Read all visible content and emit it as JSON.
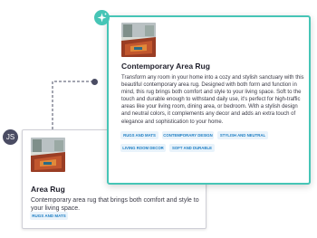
{
  "source_card": {
    "title": "Area Rug",
    "description": "Contemporary area rug that brings both comfort and style to your living space.",
    "tags": [
      "RUGS AND MATS"
    ],
    "badge_label": "JS"
  },
  "generated_card": {
    "title": "Contemporary Area Rug",
    "description": "Transform any room in your home into a cozy and stylish sanctuary with this beautiful contemporary area rug. Designed with both form and function in mind, this rug brings both comfort and style to your living space. Soft to the touch and durable enough to withstand daily use, it's perfect for high-traffic areas like your living room, dining area, or bedroom. With a stylish design and neutral colors, it complements any decor and adds an extra touch of elegance and sophistication to your home.",
    "tags": [
      "RUGS AND MATS",
      "CONTEMPORARY DESIGN",
      "STYLISH AND NEUTRAL",
      "LIVING ROOM DECOR",
      "SOFT AND DURABLE"
    ],
    "badge_icon": "sparkle-icon"
  },
  "colors": {
    "accent_teal": "#46c5b6",
    "tag_bg": "#e9f3fb",
    "tag_text": "#1f7fc4",
    "avatar_bg": "#4a4c63"
  }
}
